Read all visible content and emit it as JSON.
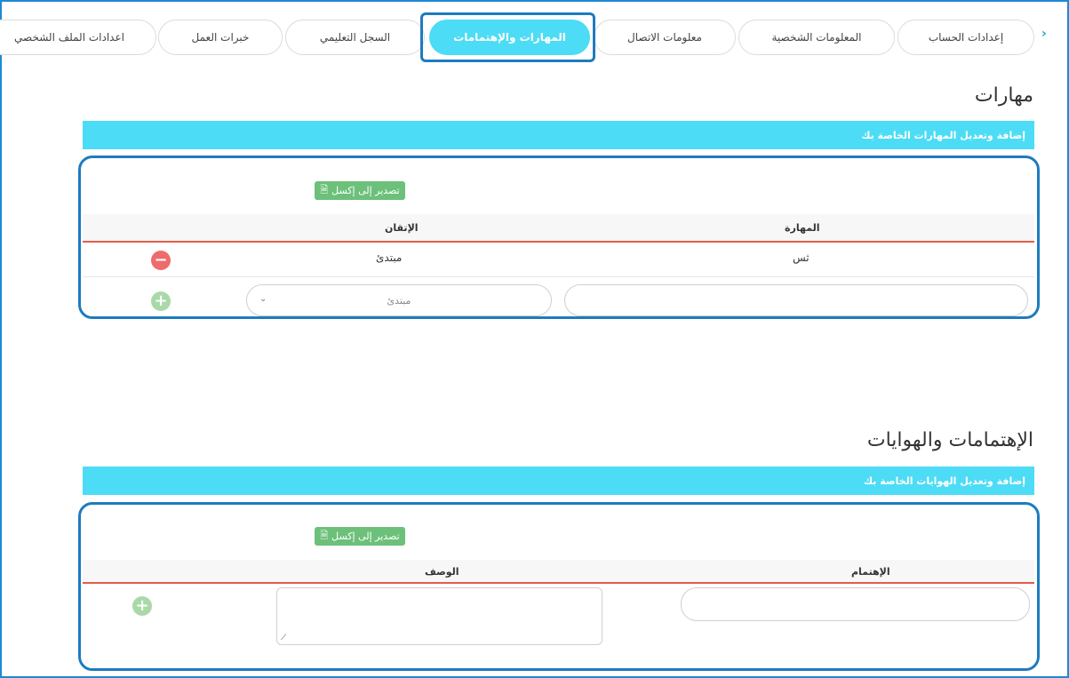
{
  "tabs": [
    {
      "label": "إعدادات الحساب"
    },
    {
      "label": "المعلومات الشخصية"
    },
    {
      "label": "معلومات الاتصال"
    },
    {
      "label": "المهارات والإهتمامات"
    },
    {
      "label": "السجل التعليمي"
    },
    {
      "label": "خبرات العمل"
    },
    {
      "label": "اعدادات الملف الشخصي"
    }
  ],
  "skills": {
    "title": "مهارات",
    "banner": "إضافة وتعديل المهارات الخاصة بك",
    "export_label": "تصدير إلى إكسل",
    "col_skill": "المهارة",
    "col_level": "الإتقان",
    "row": {
      "skill": "ثس",
      "level": "مبتدئ"
    },
    "new_level_option": "مبتدئ"
  },
  "interests": {
    "title": "الإهتمامات والهوايات",
    "banner": "إضافة وتعديل الهوايات الخاصة بك",
    "export_label": "تصدير إلى إكسل",
    "col_interest": "الإهتمام",
    "col_desc": "الوصف"
  },
  "icons": {
    "chevron": "chevron-right-icon",
    "excel": "excel-file-icon",
    "minus": "minus-circle-icon",
    "plus": "plus-circle-icon"
  },
  "colors": {
    "accent": "#4ddcf5",
    "frame": "#1e7bbf",
    "export": "#6dc07a",
    "remove": "#ef6b6b",
    "add": "#a9d9a9",
    "header_rule": "#e35d4a"
  }
}
